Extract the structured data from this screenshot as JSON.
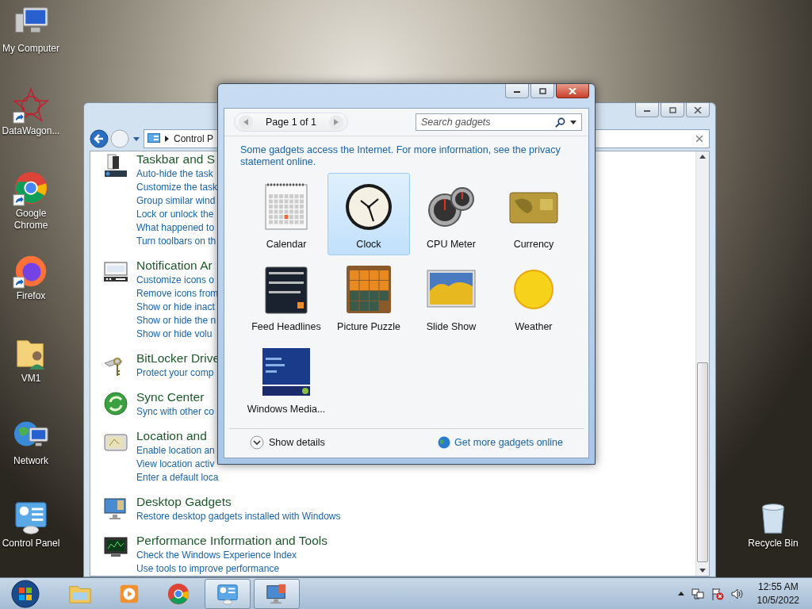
{
  "desktop_icons": [
    {
      "label": "My Computer",
      "kind": "computer",
      "shortcut": false
    },
    {
      "label": "DataWagon...",
      "kind": "star",
      "shortcut": true
    },
    {
      "label": "Google Chrome",
      "kind": "chrome",
      "shortcut": true
    },
    {
      "label": "Firefox",
      "kind": "firefox",
      "shortcut": true
    },
    {
      "label": "VM1",
      "kind": "user-folder",
      "shortcut": false
    },
    {
      "label": "Network",
      "kind": "network",
      "shortcut": false
    },
    {
      "label": "Control Panel",
      "kind": "control-panel",
      "shortcut": false
    }
  ],
  "desktop_icons_right": [
    {
      "label": "Recycle Bin",
      "kind": "recycle-bin",
      "shortcut": false
    }
  ],
  "control_panel_window": {
    "address": "Control P",
    "sections": [
      {
        "kind": "taskbar",
        "title": "Taskbar and S",
        "links": [
          "Auto-hide the task",
          "Customize the task",
          "Group similar wind",
          "Lock or unlock the",
          "What happened to",
          "Turn toolbars on th"
        ]
      },
      {
        "kind": "notification",
        "title": "Notification Ar",
        "links": [
          "Customize icons o",
          "Remove icons from",
          "Show or hide inact",
          "Show or hide the n",
          "Show or hide volu"
        ]
      },
      {
        "kind": "bitlocker",
        "title": "BitLocker Drive",
        "links": [
          "Protect your comp"
        ]
      },
      {
        "kind": "sync",
        "title": "Sync Center",
        "links": [
          "Sync with other co"
        ]
      },
      {
        "kind": "location",
        "title": "Location and",
        "links": [
          "Enable location an",
          "View location activ",
          "Enter a default loca"
        ]
      },
      {
        "kind": "gadgets",
        "title": "Desktop Gadgets",
        "links": [
          "Restore desktop gadgets installed with Windows"
        ]
      },
      {
        "kind": "performance",
        "title": "Performance Information and Tools",
        "links": [
          "Check the Windows Experience Index",
          "Use tools to improve performance"
        ]
      }
    ]
  },
  "gadgets_window": {
    "pager": "Page 1 of 1",
    "search": {
      "placeholder": "Search gadgets"
    },
    "notice": "Some gadgets access the Internet.  For more information, see the privacy statement online.",
    "gadgets": [
      {
        "name": "Calendar",
        "kind": "calendar",
        "selected": false
      },
      {
        "name": "Clock",
        "kind": "clock",
        "selected": true
      },
      {
        "name": "CPU Meter",
        "kind": "cpu",
        "selected": false
      },
      {
        "name": "Currency",
        "kind": "currency",
        "selected": false
      },
      {
        "name": "Feed Headlines",
        "kind": "feed",
        "selected": false
      },
      {
        "name": "Picture Puzzle",
        "kind": "puzzle",
        "selected": false
      },
      {
        "name": "Slide Show",
        "kind": "slideshow",
        "selected": false
      },
      {
        "name": "Weather",
        "kind": "weather",
        "selected": false
      },
      {
        "name": "Windows Media...",
        "kind": "media",
        "selected": false
      }
    ],
    "show_details": "Show details",
    "get_more": "Get more gadgets online"
  },
  "taskbar": {
    "items": [
      {
        "kind": "explorer",
        "active": false
      },
      {
        "kind": "media-player",
        "active": false
      },
      {
        "kind": "chrome",
        "active": false
      },
      {
        "kind": "control-panel",
        "active": true
      },
      {
        "kind": "gadgets",
        "active": true
      }
    ],
    "clock": {
      "time": "12:55 AM",
      "date": "10/5/2022"
    }
  }
}
